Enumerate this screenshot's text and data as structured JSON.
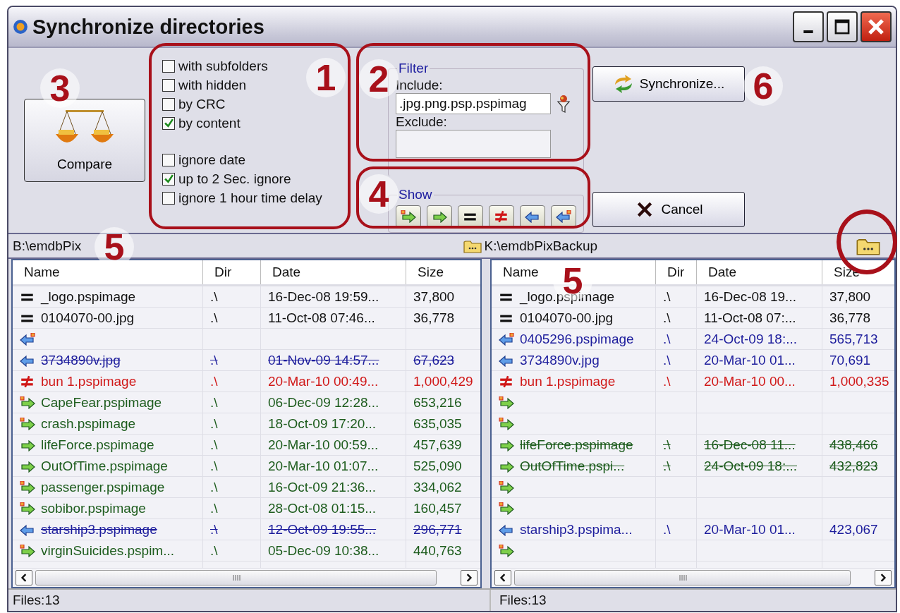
{
  "window": {
    "title": "Synchronize directories"
  },
  "compare_button": {
    "label": "Compare"
  },
  "options": [
    {
      "label": "with subfolders",
      "checked": false
    },
    {
      "label": "with hidden",
      "checked": false
    },
    {
      "label": "by CRC",
      "checked": false
    },
    {
      "label": "by content",
      "checked": true
    },
    {
      "label": "ignore date",
      "checked": false
    },
    {
      "label": "up to 2 Sec. ignore",
      "checked": true
    },
    {
      "label": "ignore 1 hour time delay",
      "checked": false
    }
  ],
  "filter": {
    "title": "Filter",
    "include_label": "Include:",
    "include_value": ".jpg.png.psp.pspimag",
    "exclude_label": "Exclude:"
  },
  "show": {
    "title": "Show",
    "buttons": [
      {
        "kind": "right_new"
      },
      {
        "kind": "right"
      },
      {
        "kind": "equal"
      },
      {
        "kind": "differ"
      },
      {
        "kind": "left"
      },
      {
        "kind": "left_new"
      }
    ]
  },
  "synchronize_button": {
    "label": "Synchronize..."
  },
  "cancel_button": {
    "label": "Cancel"
  },
  "panels": [
    {
      "path": "B:\\emdbPix",
      "columns": [
        "Name",
        "Dir",
        "Date",
        "Size"
      ],
      "status": "Files:13",
      "rows": [
        {
          "kind": "equal",
          "struck": false,
          "name": "_logo.pspimage",
          "dir": ".\\",
          "date": "16-Dec-08 19:59...",
          "size": "37,800"
        },
        {
          "kind": "equal",
          "struck": false,
          "name": "0104070-00.jpg",
          "dir": ".\\",
          "date": "11-Oct-08 07:46...",
          "size": "36,778"
        },
        {
          "kind": "left_new"
        },
        {
          "kind": "left",
          "struck": true,
          "name": "3734890v.jpg",
          "dir": ".\\",
          "date": "01-Nov-09 14:57...",
          "size": "67,623"
        },
        {
          "kind": "differ",
          "struck": false,
          "name": "bun 1.pspimage",
          "dir": ".\\",
          "date": "20-Mar-10 00:49...",
          "size": "1,000,429"
        },
        {
          "kind": "right_new",
          "struck": false,
          "name": "CapeFear.pspimage",
          "dir": ".\\",
          "date": "06-Dec-09 12:28...",
          "size": "653,216"
        },
        {
          "kind": "right_new",
          "struck": false,
          "name": "crash.pspimage",
          "dir": ".\\",
          "date": "18-Oct-09 17:20...",
          "size": "635,035"
        },
        {
          "kind": "right",
          "struck": false,
          "name": "lifeForce.pspimage",
          "dir": ".\\",
          "date": "20-Mar-10 00:59...",
          "size": "457,639"
        },
        {
          "kind": "right",
          "struck": false,
          "name": "OutOfTime.pspimage",
          "dir": ".\\",
          "date": "20-Mar-10 01:07...",
          "size": "525,090"
        },
        {
          "kind": "right_new",
          "struck": false,
          "name": "passenger.pspimage",
          "dir": ".\\",
          "date": "16-Oct-09 21:36...",
          "size": "334,062"
        },
        {
          "kind": "right_new",
          "struck": false,
          "name": "sobibor.pspimage",
          "dir": ".\\",
          "date": "28-Oct-08 01:15...",
          "size": "160,457"
        },
        {
          "kind": "left",
          "struck": true,
          "name": "starship3.pspimage",
          "dir": ".\\",
          "date": "12-Oct-09 19:55...",
          "size": "296,771"
        },
        {
          "kind": "right_new",
          "struck": false,
          "name": "virginSuicides.pspim...",
          "dir": ".\\",
          "date": "05-Dec-09 10:38...",
          "size": "440,763"
        }
      ]
    },
    {
      "path": "K:\\emdbPixBackup",
      "columns": [
        "Name",
        "Dir",
        "Date",
        "Size"
      ],
      "status": "Files:13",
      "rows": [
        {
          "kind": "equal",
          "struck": false,
          "name": "_logo.pspimage",
          "dir": ".\\",
          "date": "16-Dec-08 19...",
          "size": "37,800"
        },
        {
          "kind": "equal",
          "struck": false,
          "name": "0104070-00.jpg",
          "dir": ".\\",
          "date": "11-Oct-08 07:...",
          "size": "36,778"
        },
        {
          "kind": "left_new",
          "struck": false,
          "name": "0405296.pspimage",
          "dir": ".\\",
          "date": "24-Oct-09 18:...",
          "size": "565,713"
        },
        {
          "kind": "left",
          "struck": false,
          "name": "3734890v.jpg",
          "dir": ".\\",
          "date": "20-Mar-10 01...",
          "size": "70,691"
        },
        {
          "kind": "differ",
          "struck": false,
          "name": "bun 1.pspimage",
          "dir": ".\\",
          "date": "20-Mar-10 00...",
          "size": "1,000,335"
        },
        {
          "kind": "right_new"
        },
        {
          "kind": "right_new"
        },
        {
          "kind": "right",
          "struck": true,
          "name": "lifeForce.pspimage",
          "dir": ".\\",
          "date": "16-Dec-08 11...",
          "size": "438,466"
        },
        {
          "kind": "right",
          "struck": true,
          "name": "OutOfTime.pspi...",
          "dir": ".\\",
          "date": "24-Oct-09 18:...",
          "size": "432,823"
        },
        {
          "kind": "right_new"
        },
        {
          "kind": "right_new"
        },
        {
          "kind": "left",
          "struck": false,
          "name": "starship3.pspima...",
          "dir": ".\\",
          "date": "20-Mar-10 01...",
          "size": "423,067"
        },
        {
          "kind": "right_new"
        }
      ]
    }
  ],
  "callouts": [
    {
      "label": "3"
    },
    {
      "label": "1"
    },
    {
      "label": "2"
    },
    {
      "label": "6"
    },
    {
      "label": "4"
    },
    {
      "label": "5"
    },
    {
      "label": "5"
    }
  ]
}
